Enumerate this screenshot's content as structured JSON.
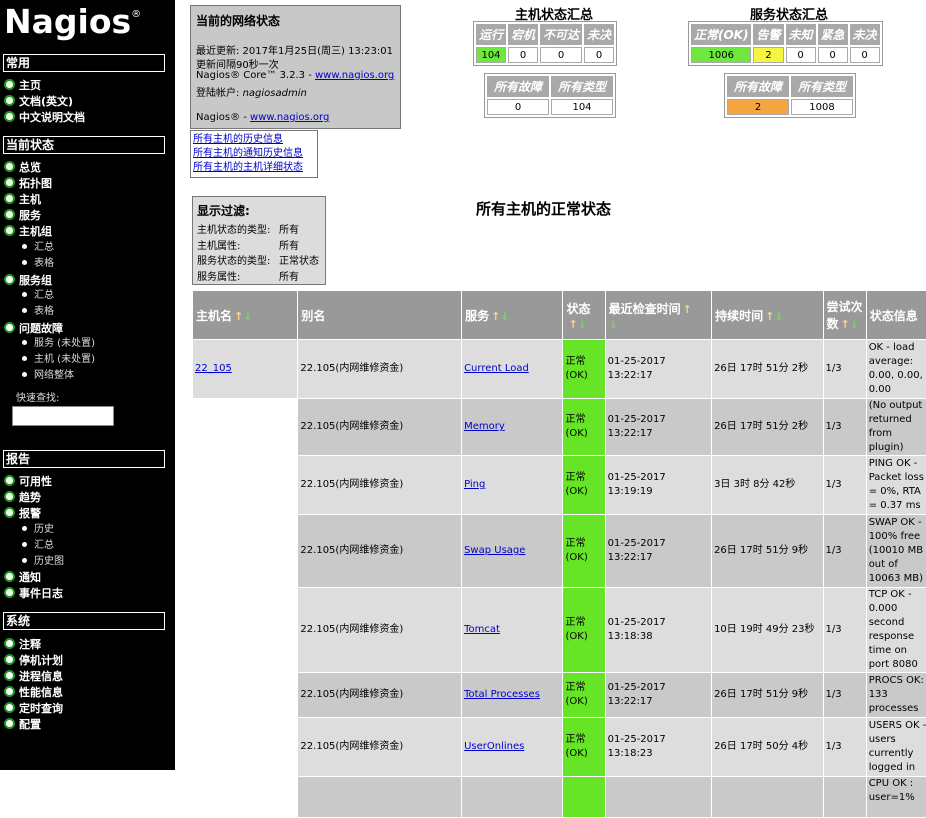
{
  "brand": {
    "name": "Nagios",
    "reg": "®"
  },
  "sidebar": {
    "sections": [
      {
        "title": "常用",
        "items": [
          "主页",
          "文档(英文)",
          "中文说明文档"
        ]
      },
      {
        "title": "当前状态",
        "items": [
          "总览",
          "拓扑图",
          "主机",
          "服务",
          "主机组",
          "汇总",
          "表格",
          "服务组",
          "汇总",
          "表格",
          "问题故障",
          "服务 (未处置)",
          "主机 (未处置)",
          "网络整体"
        ]
      },
      {
        "title": "报告",
        "items": [
          "可用性",
          "趋势",
          "报警",
          "历史",
          "汇总",
          "历史图",
          "通知",
          "事件日志"
        ]
      },
      {
        "title": "系统",
        "items": [
          "注释",
          "停机计划",
          "进程信息",
          "性能信息",
          "定时查询",
          "配置"
        ]
      }
    ],
    "quick_search_label": "快速查找:",
    "quick_search_value": ""
  },
  "netstatus": {
    "title": "当前的网络状态",
    "last_update": "最近更新: 2017年1月25日(周三) 13:23:01",
    "interval": "更新间隔90秒一次",
    "version_prefix": "Nagios® Core™ 3.2.3 - ",
    "version_link": "www.nagios.org",
    "login_prefix": "登陆帐户: ",
    "login_user": "nagiosadmin",
    "footer_prefix": "Nagios® - ",
    "footer_link": "www.nagios.org"
  },
  "history_links": [
    "所有主机的历史信息",
    "所有主机的通知历史信息",
    "所有主机的主机详细状态"
  ],
  "host_summary": {
    "title": "主机状态汇总",
    "headers": [
      "运行",
      "宕机",
      "不可达",
      "未决"
    ],
    "values": [
      "104",
      "0",
      "0",
      "0"
    ],
    "headers2": [
      "所有故障",
      "所有类型"
    ],
    "values2": [
      "0",
      "104"
    ]
  },
  "service_summary": {
    "title": "服务状态汇总",
    "headers": [
      "正常(OK)",
      "告警",
      "未知",
      "紧急",
      "未决"
    ],
    "values": [
      "1006",
      "2",
      "0",
      "0",
      "0"
    ],
    "headers2": [
      "所有故障",
      "所有类型"
    ],
    "values2": [
      "2",
      "1008"
    ]
  },
  "filter": {
    "title": "显示过滤:",
    "rows": [
      {
        "label": "主机状态的类型:",
        "value": "所有"
      },
      {
        "label": "主机属性:",
        "value": "所有"
      },
      {
        "label": "服务状态的类型:",
        "value": "正常状态"
      },
      {
        "label": "服务属性:",
        "value": "所有"
      }
    ]
  },
  "page_title": "所有主机的正常状态",
  "table": {
    "headers": [
      "主机名",
      "别名",
      "服务",
      "状态",
      "最近检查时间",
      "持续时间",
      "尝试次数",
      "状态信息"
    ],
    "rows": [
      {
        "host": "22_105",
        "alias": "22.105(内网维修资金)",
        "service": "Current Load",
        "status": "正常(OK)",
        "last_check": "01-25-2017 13:22:17",
        "duration": "26日 17时 51分 2秒",
        "attempt": "1/3",
        "info": "OK - load average: 0.00, 0.00, 0.00"
      },
      {
        "host": "",
        "alias": "22.105(内网维修资金)",
        "service": "Memory",
        "status": "正常(OK)",
        "last_check": "01-25-2017 13:22:17",
        "duration": "26日 17时 51分 2秒",
        "attempt": "1/3",
        "info": "(No output returned from plugin)"
      },
      {
        "host": "",
        "alias": "22.105(内网维修资金)",
        "service": "Ping",
        "status": "正常(OK)",
        "last_check": "01-25-2017 13:19:19",
        "duration": "3日 3时 8分 42秒",
        "attempt": "1/3",
        "info": "PING OK - Packet loss = 0%, RTA = 0.37 ms"
      },
      {
        "host": "",
        "alias": "22.105(内网维修资金)",
        "service": "Swap Usage",
        "status": "正常(OK)",
        "last_check": "01-25-2017 13:22:17",
        "duration": "26日 17时 51分 9秒",
        "attempt": "1/3",
        "info": "SWAP OK - 100% free (10010 MB out of 10063 MB)"
      },
      {
        "host": "",
        "alias": "22.105(内网维修资金)",
        "service": "Tomcat",
        "status": "正常(OK)",
        "last_check": "01-25-2017 13:18:38",
        "duration": "10日 19时 49分 23秒",
        "attempt": "1/3",
        "info": "TCP OK - 0.000 second response time on port 8080"
      },
      {
        "host": "",
        "alias": "22.105(内网维修资金)",
        "service": "Total Processes",
        "status": "正常(OK)",
        "last_check": "01-25-2017 13:22:17",
        "duration": "26日 17时 51分 9秒",
        "attempt": "1/3",
        "info": "PROCS OK: 133 processes"
      },
      {
        "host": "",
        "alias": "22.105(内网维修资金)",
        "service": "UserOnlines",
        "status": "正常(OK)",
        "last_check": "01-25-2017 13:18:23",
        "duration": "26日 17时 50分 4秒",
        "attempt": "1/3",
        "info": "USERS OK - users currently logged in"
      },
      {
        "host": "",
        "alias": "",
        "service": "",
        "status": "",
        "last_check": "",
        "duration": "",
        "attempt": "",
        "info": "CPU OK : user=1%"
      }
    ]
  }
}
